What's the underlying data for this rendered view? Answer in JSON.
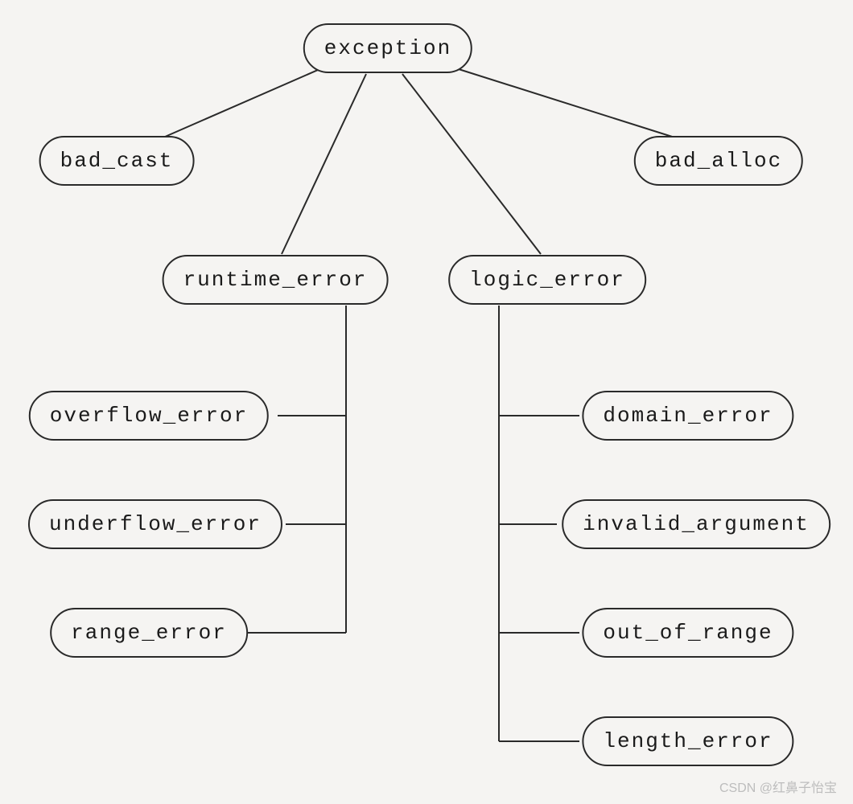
{
  "nodes": {
    "root": "exception",
    "bad_cast": "bad_cast",
    "bad_alloc": "bad_alloc",
    "runtime_error": "runtime_error",
    "logic_error": "logic_error",
    "overflow_error": "overflow_error",
    "underflow_error": "underflow_error",
    "range_error": "range_error",
    "domain_error": "domain_error",
    "invalid_argument": "invalid_argument",
    "out_of_range": "out_of_range",
    "length_error": "length_error"
  },
  "watermark": "CSDN @红鼻子怡宝"
}
